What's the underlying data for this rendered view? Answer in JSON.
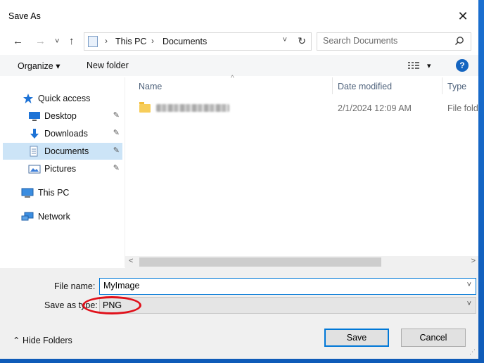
{
  "window": {
    "title": "Save As",
    "close_glyph": "✕"
  },
  "address": {
    "back_glyph": "←",
    "forward_glyph": "→",
    "recent_glyph": "˅",
    "up_glyph": "↑",
    "crumbs": [
      "This PC",
      "Documents"
    ],
    "crumb_sep": "›",
    "dropdown_glyph": "˅",
    "refresh_glyph": "↻"
  },
  "search": {
    "placeholder": "Search Documents"
  },
  "toolbar": {
    "organize": "Organize ▾",
    "new_folder": "New folder",
    "view_caret": "▾",
    "help": "?"
  },
  "sidebar": {
    "items": [
      {
        "label": "Quick access",
        "icon": "star-icon"
      },
      {
        "label": "Desktop",
        "icon": "desktop-icon",
        "pinned": true
      },
      {
        "label": "Downloads",
        "icon": "download-icon",
        "pinned": true
      },
      {
        "label": "Documents",
        "icon": "documents-icon",
        "pinned": true,
        "selected": true
      },
      {
        "label": "Pictures",
        "icon": "pictures-icon",
        "pinned": true
      },
      {
        "label": "This PC",
        "icon": "computer-icon"
      },
      {
        "label": "Network",
        "icon": "network-icon"
      }
    ],
    "pin_glyph": "📌"
  },
  "columns": {
    "name": "Name",
    "date": "Date modified",
    "type": "Type",
    "sort_glyph": "^"
  },
  "files": [
    {
      "date": "2/1/2024 12:09 AM",
      "type": "File fold"
    }
  ],
  "scroll": {
    "left": "<",
    "right": ">"
  },
  "form": {
    "file_name_label": "File name:",
    "file_name_value": "MyImage",
    "save_type_label": "Save as type:",
    "save_type_value": "PNG",
    "dropdown_glyph": "˅"
  },
  "footer": {
    "hide_folders": "⌃  Hide Folders",
    "save": "Save",
    "cancel": "Cancel"
  },
  "colors": {
    "accent": "#0078d7",
    "selection": "#cce4f7",
    "highlight_oval": "#e0101a",
    "help": "#1565c0"
  }
}
